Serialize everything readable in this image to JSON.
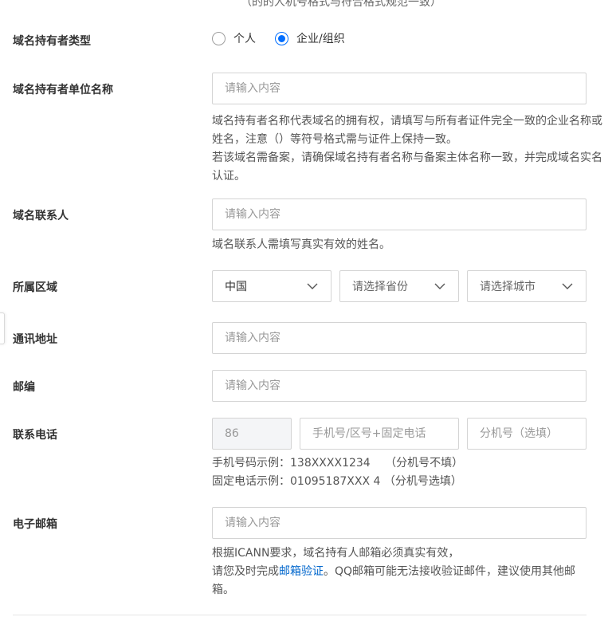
{
  "top_clip": "（的的人机号格式与符合格式规范一致）",
  "holder_type": {
    "label": "域名持有者类型",
    "options": [
      {
        "label": "个人",
        "checked": false
      },
      {
        "label": "企业/组织",
        "checked": true
      }
    ]
  },
  "holder_name": {
    "label": "域名持有者单位名称",
    "placeholder": "请输入内容",
    "help": [
      "域名持有者名称代表域名的拥有权，请填写与所有者证件完全一致的企业名称或姓名，注意（）等符号格式需与证件上保持一致。",
      "若该域名需备案，请确保域名持有者名称与备案主体名称一致，并完成域名实名认证。"
    ]
  },
  "contact": {
    "label": "域名联系人",
    "placeholder": "请输入内容",
    "help": "域名联系人需填写真实有效的姓名。"
  },
  "region": {
    "label": "所属区域",
    "country": "中国",
    "province_placeholder": "请选择省份",
    "city_placeholder": "请选择城市"
  },
  "address": {
    "label": "通讯地址",
    "placeholder": "请输入内容"
  },
  "postcode": {
    "label": "邮编",
    "placeholder": "请输入内容"
  },
  "phone": {
    "label": "联系电话",
    "country_code": "86",
    "number_placeholder": "手机号/区号+固定电话",
    "ext_placeholder": "分机号（选填）",
    "help": [
      "手机号码示例：138XXXX1234　 （分机号不填）",
      "固定电话示例：01095187XXX 4 （分机号选填）"
    ]
  },
  "email": {
    "label": "电子邮箱",
    "placeholder": "请输入内容",
    "help_line1": "根据ICANN要求，域名持有人邮箱必须真实有效，",
    "help_prefix": "请您及时完成",
    "help_link": "邮箱验证",
    "help_suffix": "。QQ邮箱可能无法接收验证邮件，建议使用其他邮箱。"
  },
  "icons": {
    "select_arrow": "chevron-down-icon"
  },
  "colors": {
    "accent": "#006eff",
    "link": "#0066cc",
    "border": "#d4d4d4"
  }
}
